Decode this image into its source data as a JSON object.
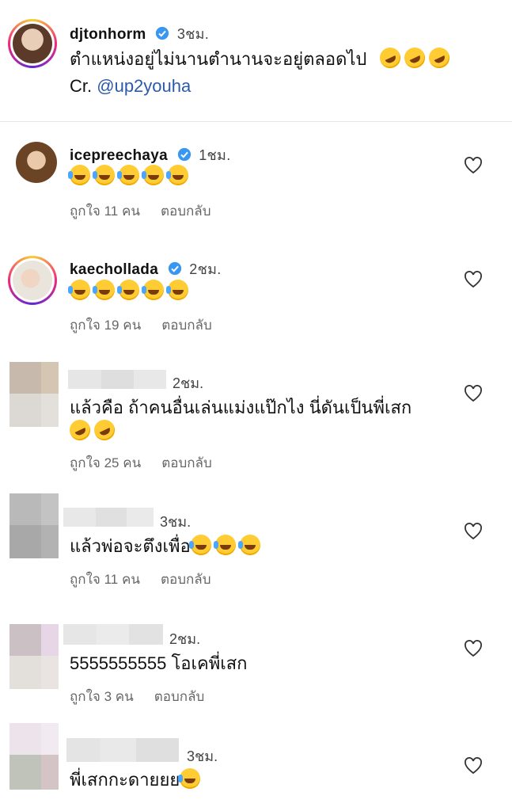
{
  "caption": {
    "username": "djtonhorm",
    "time": "3ชม.",
    "text": "ตำแหน่งอยู่ไม่นานตำนานจะอยู่ตลอดไป",
    "credit_prefix": "Cr.",
    "credit_mention": "@up2youha"
  },
  "comments": [
    {
      "username": "icepreechaya",
      "time": "1ชม.",
      "likes": "ถูกใจ 11 คน",
      "reply": "ตอบกลับ",
      "text": ""
    },
    {
      "username": "kaechollada",
      "time": "2ชม.",
      "likes": "ถูกใจ 19 คน",
      "reply": "ตอบกลับ",
      "text": ""
    },
    {
      "username": "",
      "time": "2ชม.",
      "likes": "ถูกใจ 25 คน",
      "reply": "ตอบกลับ",
      "text": "แล้วคือ ถ้าคนอื่นเล่นแม่งแป๊กไง นี่ดันเป็นพี่เสก"
    },
    {
      "username": "",
      "time": "3ชม.",
      "likes": "ถูกใจ 11 คน",
      "reply": "ตอบกลับ",
      "text": "แล้วพ่อจะตึงเพื่อ"
    },
    {
      "username": "",
      "time": "2ชม.",
      "likes": "ถูกใจ 3 คน",
      "reply": "ตอบกลับ",
      "text": "5555555555 โอเคพี่เสก"
    },
    {
      "username": "",
      "time": "3ชม.",
      "likes": "",
      "reply": "",
      "text": "พี่เสกกะดายยย"
    }
  ],
  "icons": {
    "verified": "verified-badge-icon",
    "heart": "heart-outline-icon"
  },
  "colors": {
    "mention": "#2b5aa8",
    "verified": "#3897f0"
  }
}
